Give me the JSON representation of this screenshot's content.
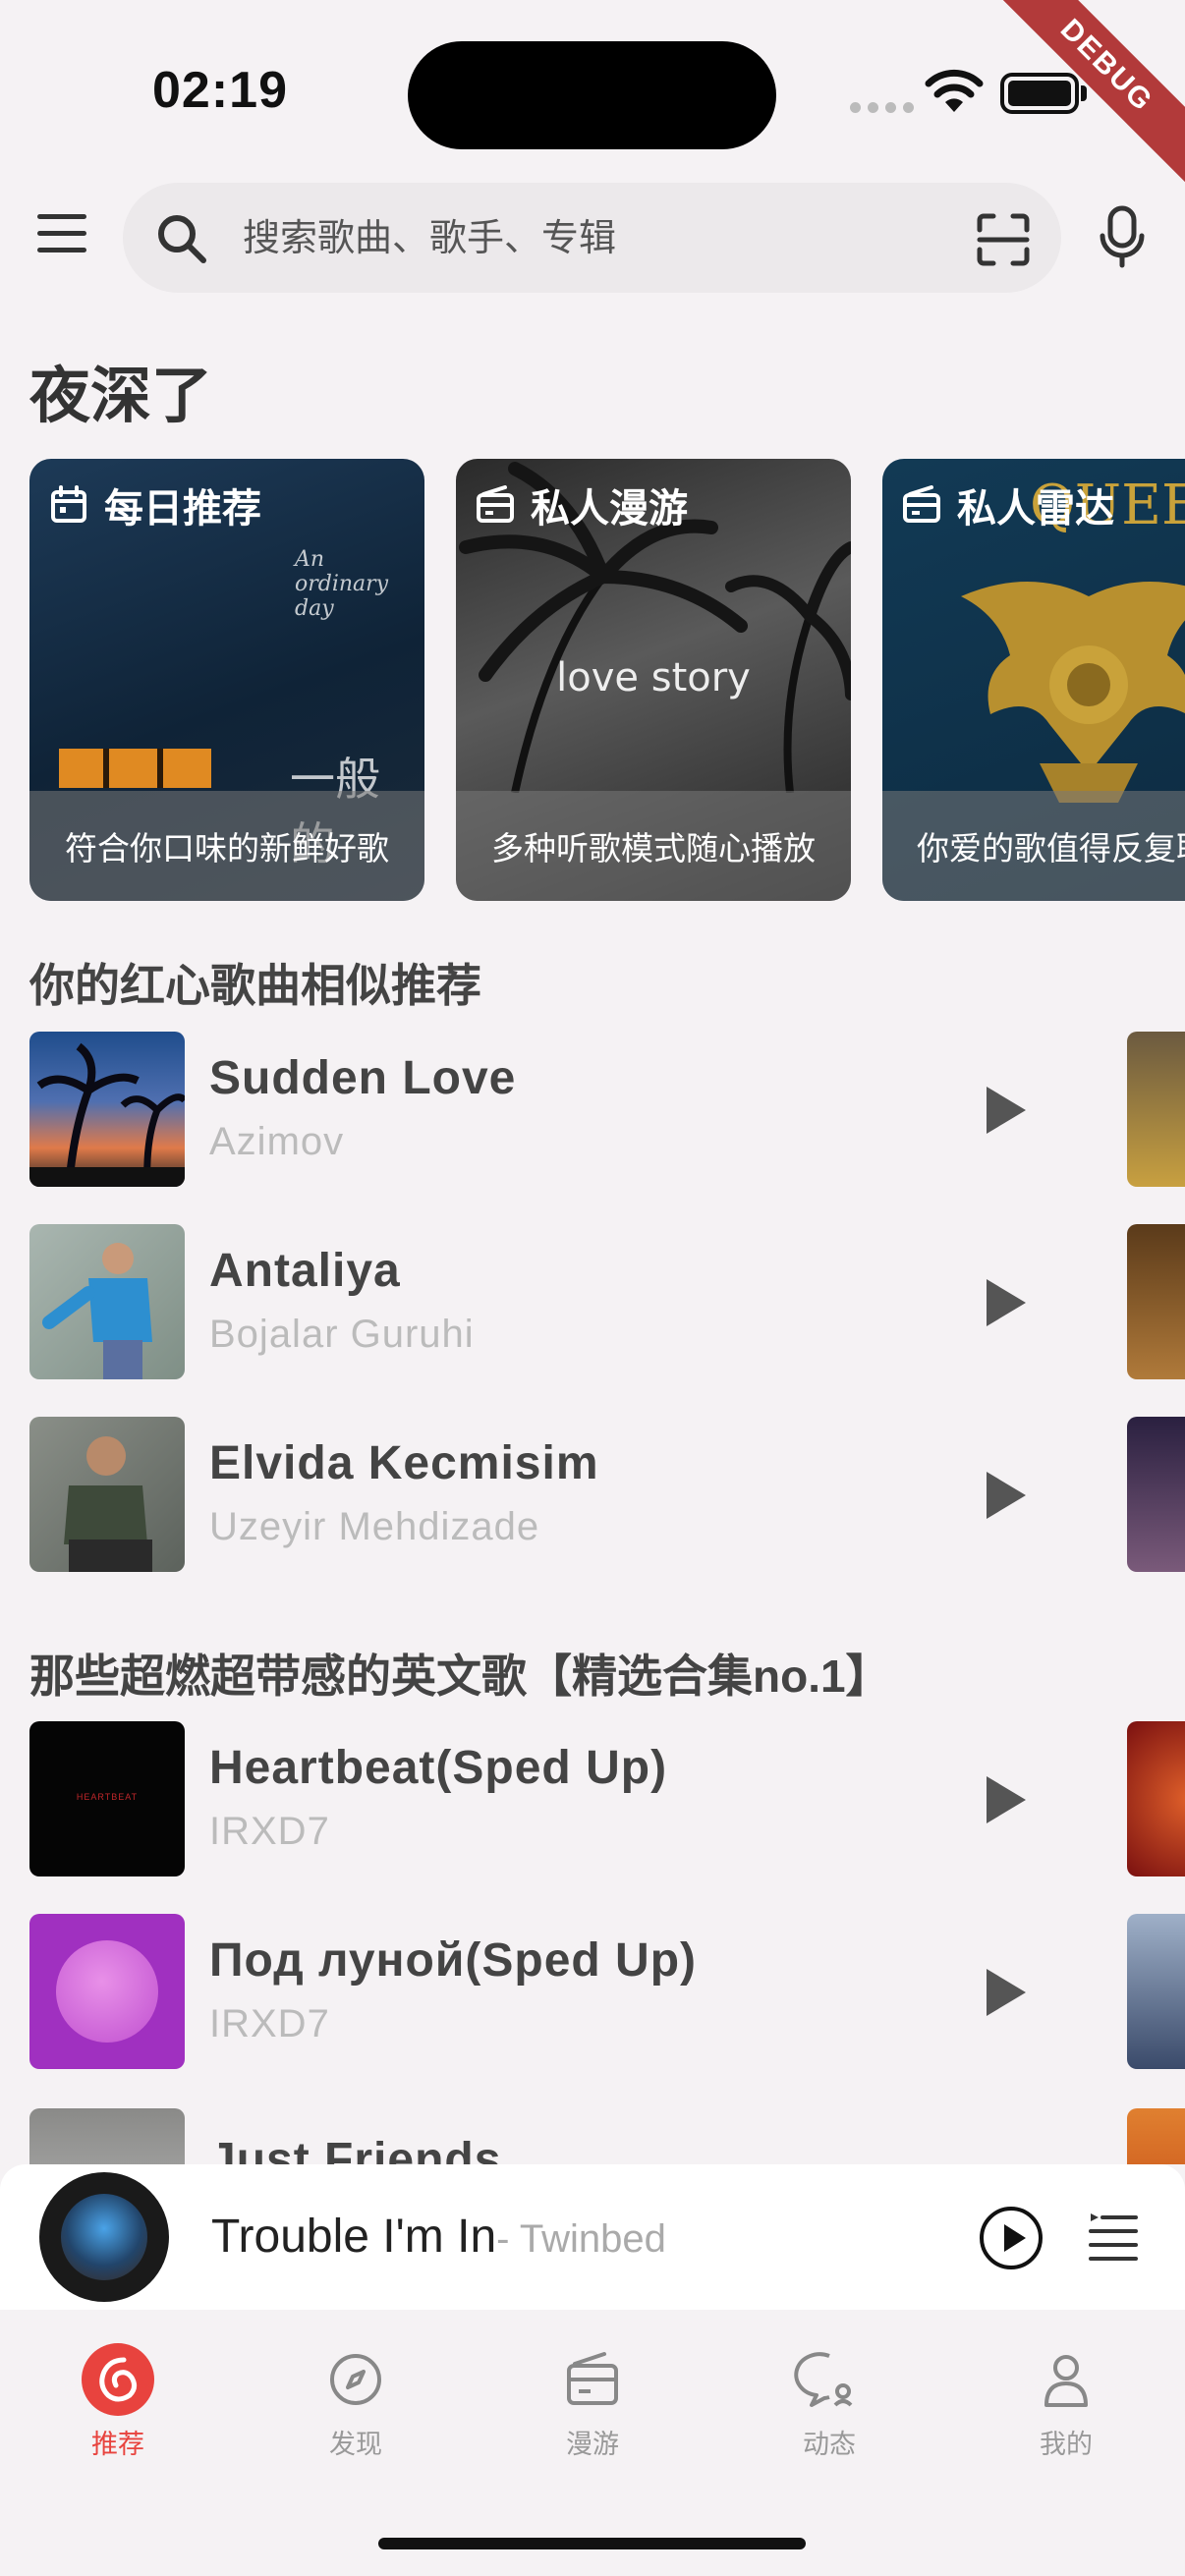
{
  "status_bar": {
    "time": "02:19",
    "debug_label": "DEBUG"
  },
  "search": {
    "placeholder": "搜索歌曲、歌手、专辑"
  },
  "greeting": "夜深了",
  "cards": [
    {
      "title": "每日推荐",
      "subtitle": "符合你口味的新鲜好歌",
      "icon": "calendar-icon",
      "art_text": "一般的"
    },
    {
      "title": "私人漫游",
      "subtitle": "多种听歌模式随心播放",
      "icon": "radio-icon",
      "art_text": "love story"
    },
    {
      "title": "私人雷达",
      "subtitle": "你爱的歌值得反复聆听",
      "icon": "radio-icon",
      "art_text": "QUEEN"
    }
  ],
  "sections": [
    {
      "title": "你的红心歌曲相似推荐",
      "songs": [
        {
          "title": "Sudden Love",
          "artist": "Azimov"
        },
        {
          "title": "Antaliya",
          "artist": "Bojalar Guruhi"
        },
        {
          "title": "Elvida Kecmisim",
          "artist": "Uzeyir Mehdizade"
        }
      ]
    },
    {
      "title": "那些超燃超带感的英文歌【精选合集no.1】",
      "songs": [
        {
          "title": "Heartbeat(Sped Up)",
          "artist": "IRXD7"
        },
        {
          "title": "Под луной(Sped Up)",
          "artist": "IRXD7"
        },
        {
          "title": "Just Friends",
          "artist": ""
        }
      ]
    }
  ],
  "now_playing": {
    "title": "Trouble I'm In",
    "artist": "- Twinbed"
  },
  "tabs": [
    {
      "label": "推荐",
      "icon": "netease-music-icon",
      "active": true
    },
    {
      "label": "发现",
      "icon": "compass-icon",
      "active": false
    },
    {
      "label": "漫游",
      "icon": "radio-icon",
      "active": false
    },
    {
      "label": "动态",
      "icon": "chat-icon",
      "active": false
    },
    {
      "label": "我的",
      "icon": "person-icon",
      "active": false
    }
  ],
  "colors": {
    "accent": "#e8433e",
    "background": "#f5f2f4"
  }
}
